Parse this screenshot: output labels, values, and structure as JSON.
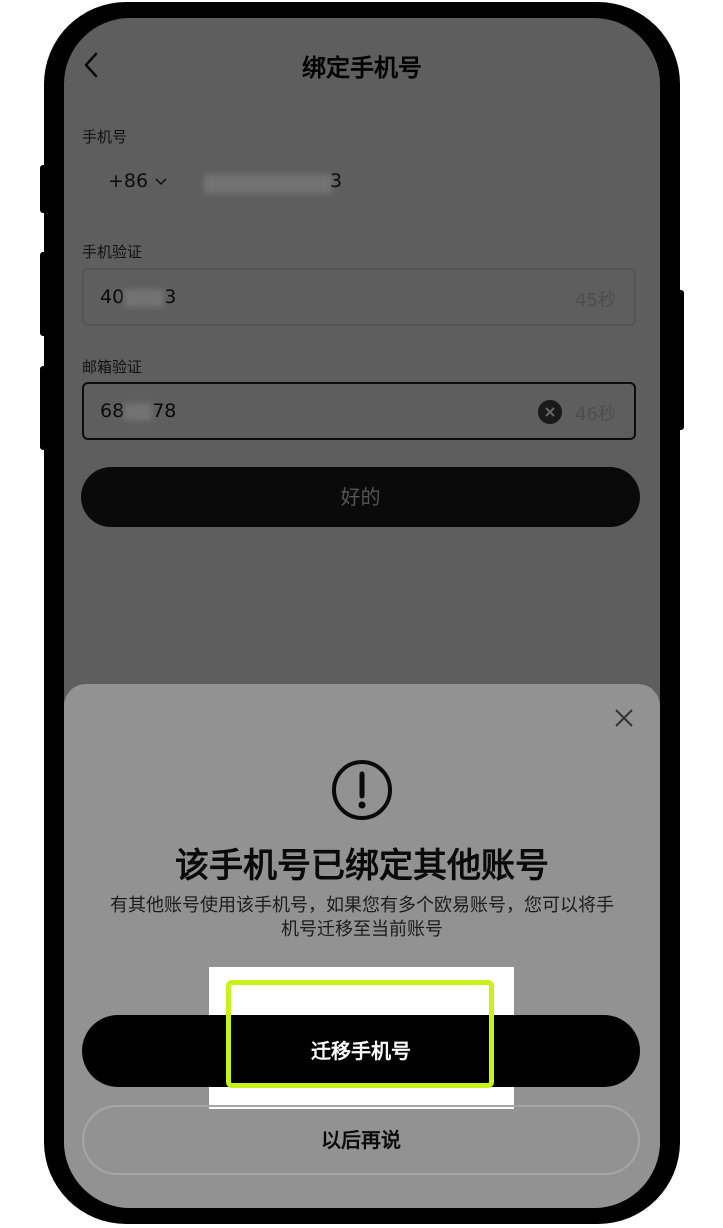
{
  "header": {
    "title": "绑定手机号",
    "back_icon": "chevron-left-icon"
  },
  "phone_section": {
    "label": "手机号",
    "country_code": "+86",
    "number_visible_tail": "3"
  },
  "phone_verify": {
    "label": "手机验证",
    "value_prefix": "40",
    "value_suffix": "3",
    "timer": "45秒"
  },
  "email_verify": {
    "label": "邮箱验证",
    "value_prefix": "68",
    "value_suffix": "78",
    "timer": "46秒"
  },
  "ok_button": {
    "label": "好的"
  },
  "dialog": {
    "title": "该手机号已绑定其他账号",
    "description": "有其他账号使用该手机号，如果您有多个欧易账号，您可以将手机号迁移至当前账号",
    "primary_button": "迁移手机号",
    "secondary_button": "以后再说",
    "highlight_color": "#c7f21a"
  }
}
